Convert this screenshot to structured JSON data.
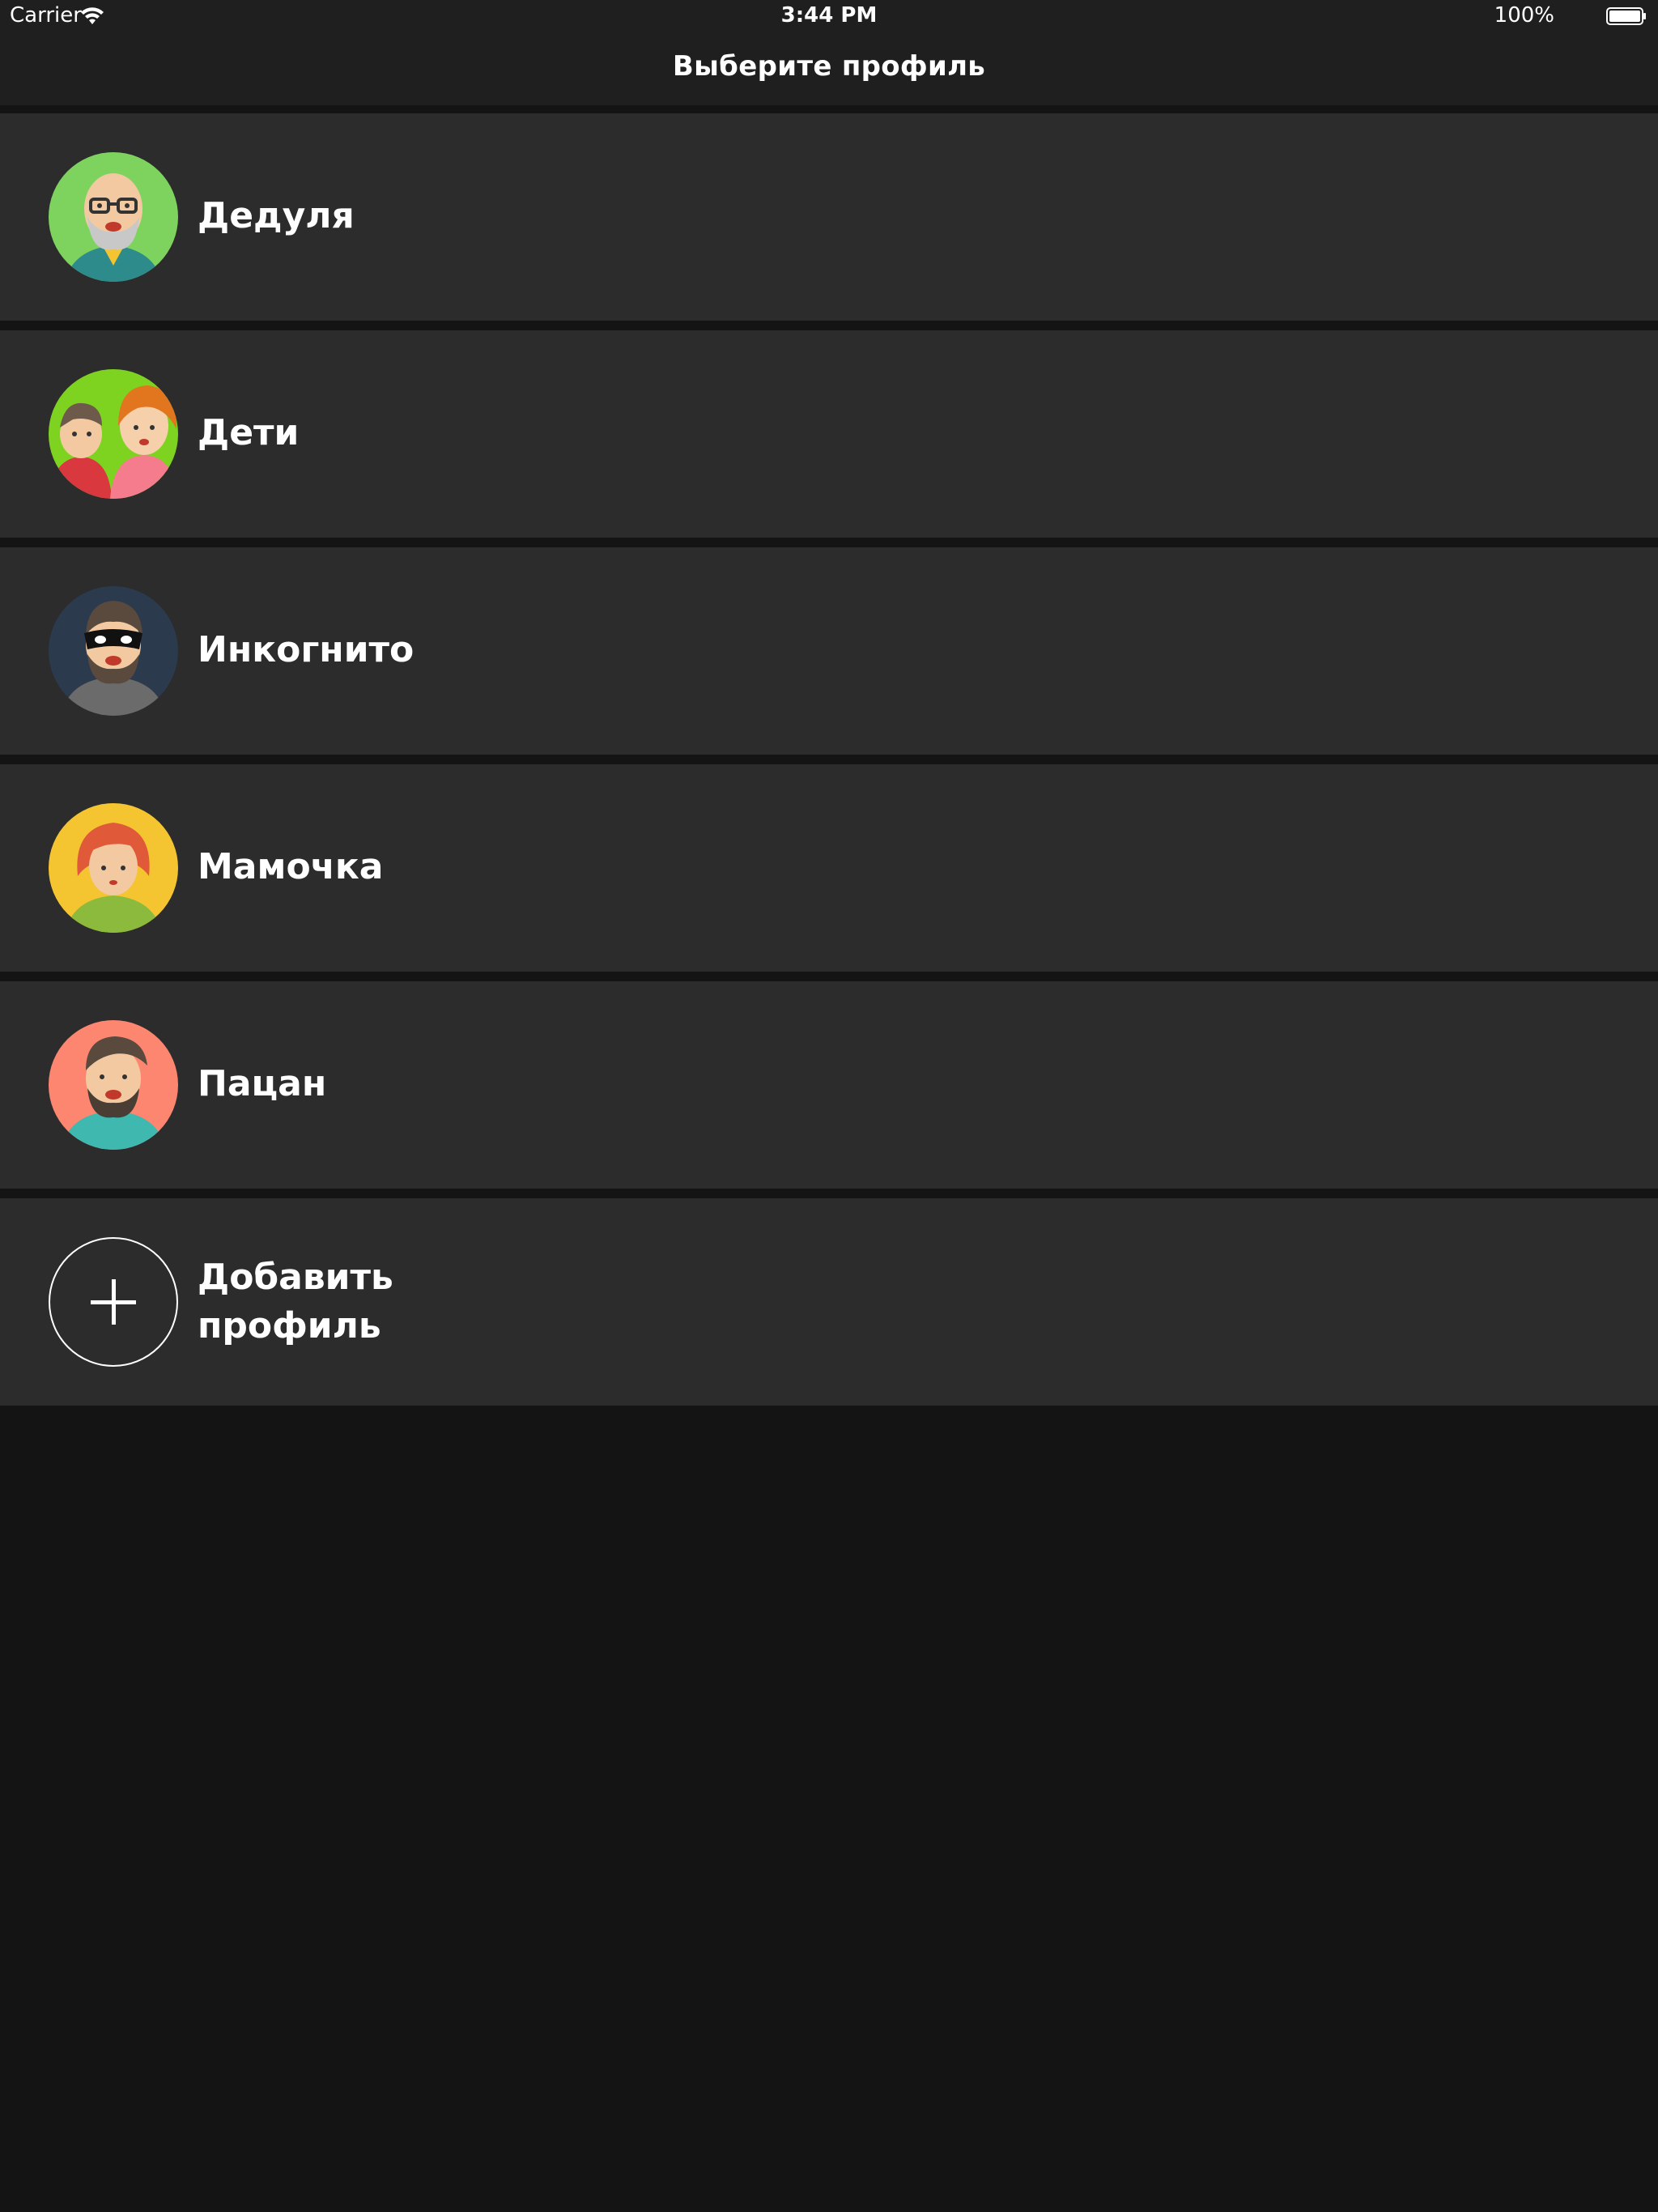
{
  "status_bar": {
    "carrier": "Carrier",
    "time": "3:44 PM",
    "battery": "100%"
  },
  "nav": {
    "title": "Выберите профиль"
  },
  "profiles": [
    {
      "name": "Дедуля",
      "avatar": "grandpa-avatar",
      "color": "#7ed35f"
    },
    {
      "name": "Дети",
      "avatar": "kids-avatar",
      "color": "#7ed321"
    },
    {
      "name": "Инкогнито",
      "avatar": "incognito-avatar",
      "color": "#2b3a4d"
    },
    {
      "name": "Мамочка",
      "avatar": "mom-avatar",
      "color": "#f5c431"
    },
    {
      "name": "Пацан",
      "avatar": "guy-avatar",
      "color": "#fd8671"
    }
  ],
  "add_profile": {
    "line1": "Добавить",
    "line2": "профиль",
    "icon": "plus-icon"
  },
  "colors": {
    "background": "#141414",
    "bar": "#1f1f1f",
    "row": "#2c2c2c",
    "text": "#ffffff"
  }
}
